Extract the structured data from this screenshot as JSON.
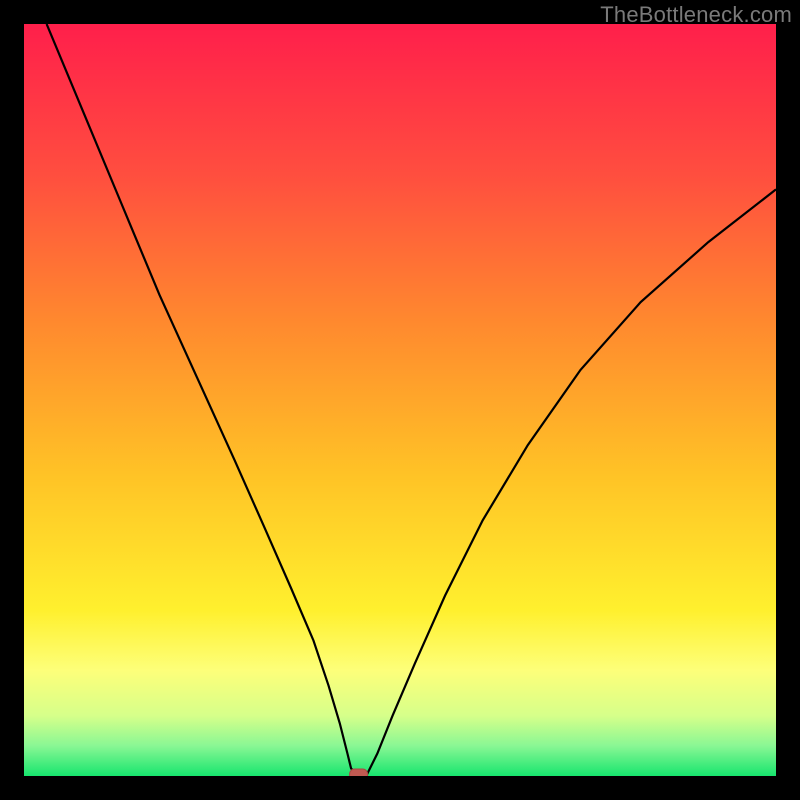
{
  "watermark": "TheBottleneck.com",
  "chart_data": {
    "type": "line",
    "title": "",
    "xlabel": "",
    "ylabel": "",
    "xlim": [
      0,
      100
    ],
    "ylim": [
      0,
      100
    ],
    "series": [
      {
        "name": "bottleneck-curve",
        "x": [
          3,
          8,
          13,
          18,
          23,
          28,
          32,
          35.5,
          38.5,
          40.5,
          42,
          43,
          43.5,
          44.5,
          45.5,
          47,
          49,
          52,
          56,
          61,
          67,
          74,
          82,
          91,
          100
        ],
        "values": [
          100,
          88,
          76,
          64,
          53,
          42,
          33,
          25,
          18,
          12,
          7,
          3,
          1,
          0,
          0,
          3,
          8,
          15,
          24,
          34,
          44,
          54,
          63,
          71,
          78
        ]
      }
    ],
    "flat_segment": {
      "x0": 43.5,
      "x1": 45.5,
      "y": 0
    },
    "marker": {
      "x": 44.5,
      "y": 0
    },
    "background_gradient": {
      "stops": [
        {
          "offset": 0.0,
          "color": "#ff1f4b"
        },
        {
          "offset": 0.2,
          "color": "#ff4e3f"
        },
        {
          "offset": 0.4,
          "color": "#ff8a2e"
        },
        {
          "offset": 0.6,
          "color": "#ffc326"
        },
        {
          "offset": 0.78,
          "color": "#fff02e"
        },
        {
          "offset": 0.86,
          "color": "#fdff7a"
        },
        {
          "offset": 0.92,
          "color": "#d6ff8a"
        },
        {
          "offset": 0.96,
          "color": "#89f794"
        },
        {
          "offset": 1.0,
          "color": "#17e56e"
        }
      ]
    }
  }
}
